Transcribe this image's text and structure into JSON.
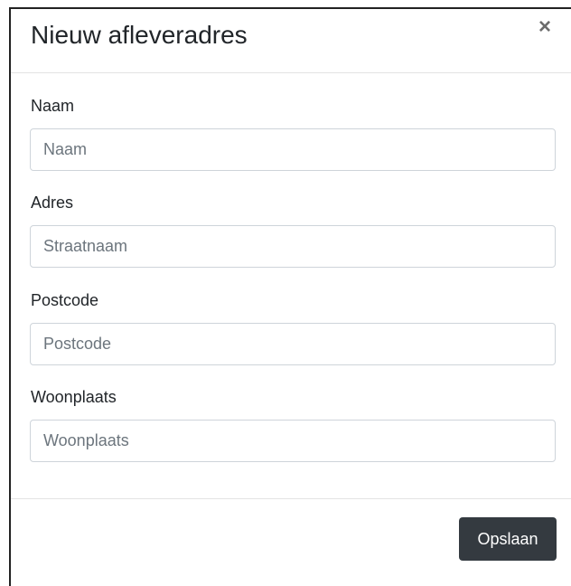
{
  "modal": {
    "title": "Nieuw afleveradres",
    "close_symbol": "×",
    "save_label": "Opslaan"
  },
  "fields": [
    {
      "label": "Naam",
      "placeholder": "Naam",
      "value": ""
    },
    {
      "label": "Adres",
      "placeholder": "Straatnaam",
      "value": ""
    },
    {
      "label": "Postcode",
      "placeholder": "Postcode",
      "value": ""
    },
    {
      "label": "Woonplaats",
      "placeholder": "Woonplaats",
      "value": ""
    }
  ],
  "colors": {
    "primary_button": "#343a40",
    "border": "#ced4da"
  }
}
